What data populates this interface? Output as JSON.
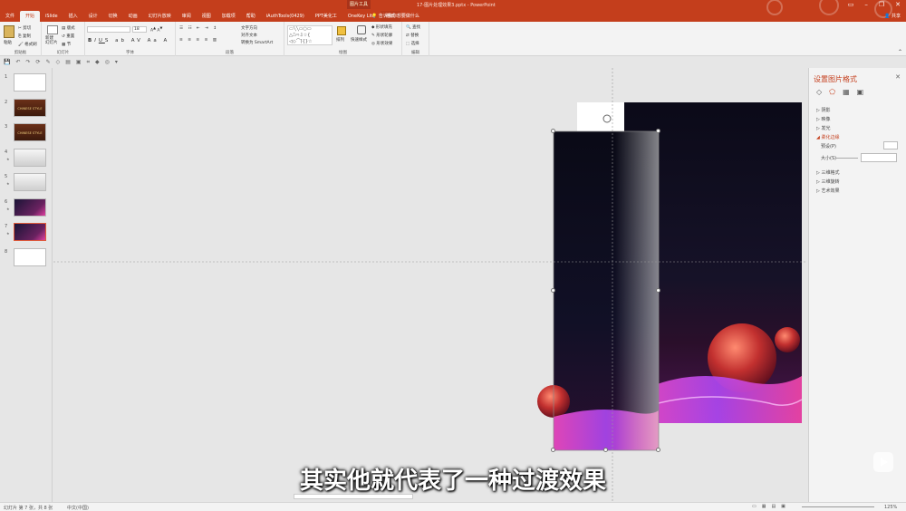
{
  "app": {
    "title": "17-图片处理效果3.pptx - PowerPoint",
    "context_tab_group": "图片工具",
    "tabs": [
      "文件",
      "开始",
      "iSlide",
      "插入",
      "设计",
      "切换",
      "动画",
      "幻灯片放映",
      "审阅",
      "视图",
      "加载项",
      "帮助",
      "iAuthTools(0429)",
      "PPT美化工",
      "OneKey Lite",
      "格式"
    ],
    "active_tab": "开始",
    "tell_me": "告诉我你想要做什么",
    "share": "共享"
  },
  "ribbon": {
    "clipboard": {
      "paste": "粘贴",
      "cut": "剪切",
      "copy": "复制",
      "format_painter": "格式刷",
      "label": "剪贴板"
    },
    "slides": {
      "new_slide": "新建\n幻灯片",
      "layout": "版式",
      "reset": "重置",
      "section": "节",
      "label": "幻灯片"
    },
    "font": {
      "size": "18",
      "label": "字体"
    },
    "paragraph": {
      "text_direction": "文字方向",
      "align_text": "对齐文本",
      "smartart": "转换为 SmartArt",
      "label": "段落"
    },
    "drawing": {
      "arrange": "排列",
      "quick_styles": "快速样式",
      "shape_fill": "形状填充",
      "shape_outline": "形状轮廓",
      "shape_effects": "形状效果",
      "label": "绘图"
    },
    "editing": {
      "find": "查找",
      "replace": "替换",
      "select": "选择",
      "label": "编辑"
    }
  },
  "thumbnails": [
    {
      "num": "1",
      "style": "white"
    },
    {
      "num": "2",
      "style": "chinese",
      "text": "CHINESE STYLE"
    },
    {
      "num": "3",
      "style": "chinese",
      "text": "CHINESE STYLE"
    },
    {
      "num": "4",
      "style": "grey",
      "star": "★"
    },
    {
      "num": "5",
      "style": "grey",
      "star": "★"
    },
    {
      "num": "6",
      "style": "dark",
      "star": "★"
    },
    {
      "num": "7",
      "style": "dark",
      "star": "★",
      "selected": true
    },
    {
      "num": "8",
      "style": "white"
    }
  ],
  "format_pane": {
    "title": "设置图片格式",
    "close": "✕",
    "sections": [
      "阴影",
      "映像",
      "发光",
      "柔化边缘",
      "三维格式",
      "三维旋转",
      "艺术效果"
    ],
    "open_section": "柔化边缘",
    "preset_label": "预设(P)",
    "size_label": "大小(S)"
  },
  "status": {
    "slide_info": "幻灯片 第 7 张，共 8 张",
    "language": "中文(中国)",
    "zoom": "125%"
  },
  "subtitle": "其实他就代表了一种过渡效果",
  "colors": {
    "accent": "#c43e1c",
    "ribbon": "#f3f3f3",
    "canvas": "#e6e6e6"
  }
}
